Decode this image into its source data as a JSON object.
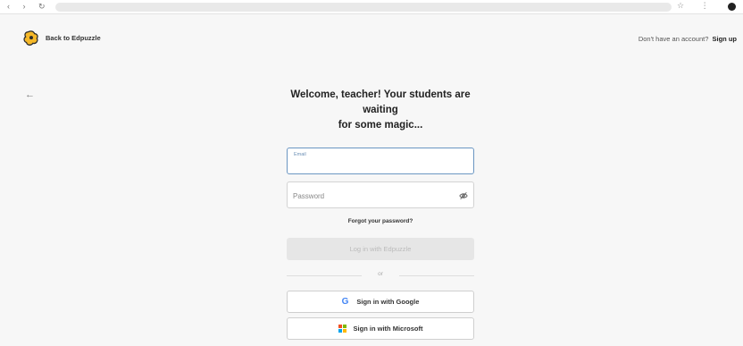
{
  "header": {
    "back_link": "Back to Edpuzzle",
    "no_account_text": "Don't have an account?",
    "signup_link": "Sign up"
  },
  "icons": {
    "logo": "edpuzzle-logo-icon",
    "back": "arrow-left-icon",
    "password_toggle": "eye-slash-icon",
    "google": "google-icon",
    "microsoft": "microsoft-icon"
  },
  "login": {
    "title_line1": "Welcome, teacher! Your students are waiting",
    "title_line2": "for some magic...",
    "email_label": "Email",
    "email_value": "",
    "password_placeholder": "Password",
    "forgot_password": "Forgot your password?",
    "login_button": "Log in with Edpuzzle",
    "divider_text": "or",
    "google_button": "Sign in with Google",
    "microsoft_button": "Sign in with Microsoft"
  },
  "colors": {
    "background": "#f7f7f7",
    "focus_border": "#6b96c2",
    "logo_yellow": "#f5b829",
    "google_blue": "#4285F4",
    "ms_red": "#f25022",
    "ms_green": "#7fba00",
    "ms_blue": "#00a4ef",
    "ms_yellow": "#ffb900"
  }
}
